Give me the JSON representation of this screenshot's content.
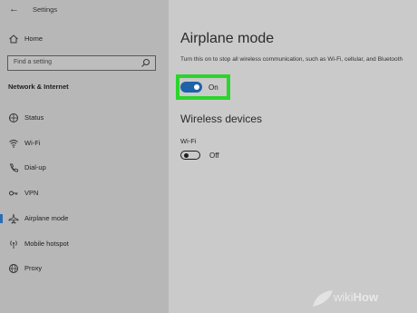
{
  "app": {
    "title": "Settings"
  },
  "sidebar": {
    "home_label": "Home",
    "search_placeholder": "Find a setting",
    "section_title": "Network & Internet",
    "items": [
      {
        "label": "Status",
        "icon": "globe-icon"
      },
      {
        "label": "Wi-Fi",
        "icon": "wifi-icon"
      },
      {
        "label": "Dial-up",
        "icon": "phone-icon"
      },
      {
        "label": "VPN",
        "icon": "vpn-icon"
      },
      {
        "label": "Airplane mode",
        "icon": "airplane-icon",
        "selected": true
      },
      {
        "label": "Mobile hotspot",
        "icon": "hotspot-icon"
      },
      {
        "label": "Proxy",
        "icon": "globe-icon"
      }
    ]
  },
  "main": {
    "title": "Airplane mode",
    "description": "Turn this on to stop all wireless communication, such as Wi-Fi, cellular, and Bluetooth",
    "airplane_toggle": {
      "state": "On",
      "checked": true
    },
    "wireless_heading": "Wireless devices",
    "wifi": {
      "label": "Wi-Fi",
      "state": "Off",
      "checked": false
    }
  },
  "colors": {
    "accent": "#1e63a8",
    "highlight": "#2bd52b",
    "sidebar_bg": "#b7b7b7",
    "main_bg": "#cacaca"
  },
  "watermark": {
    "part1": "wiki",
    "part2": "How"
  }
}
